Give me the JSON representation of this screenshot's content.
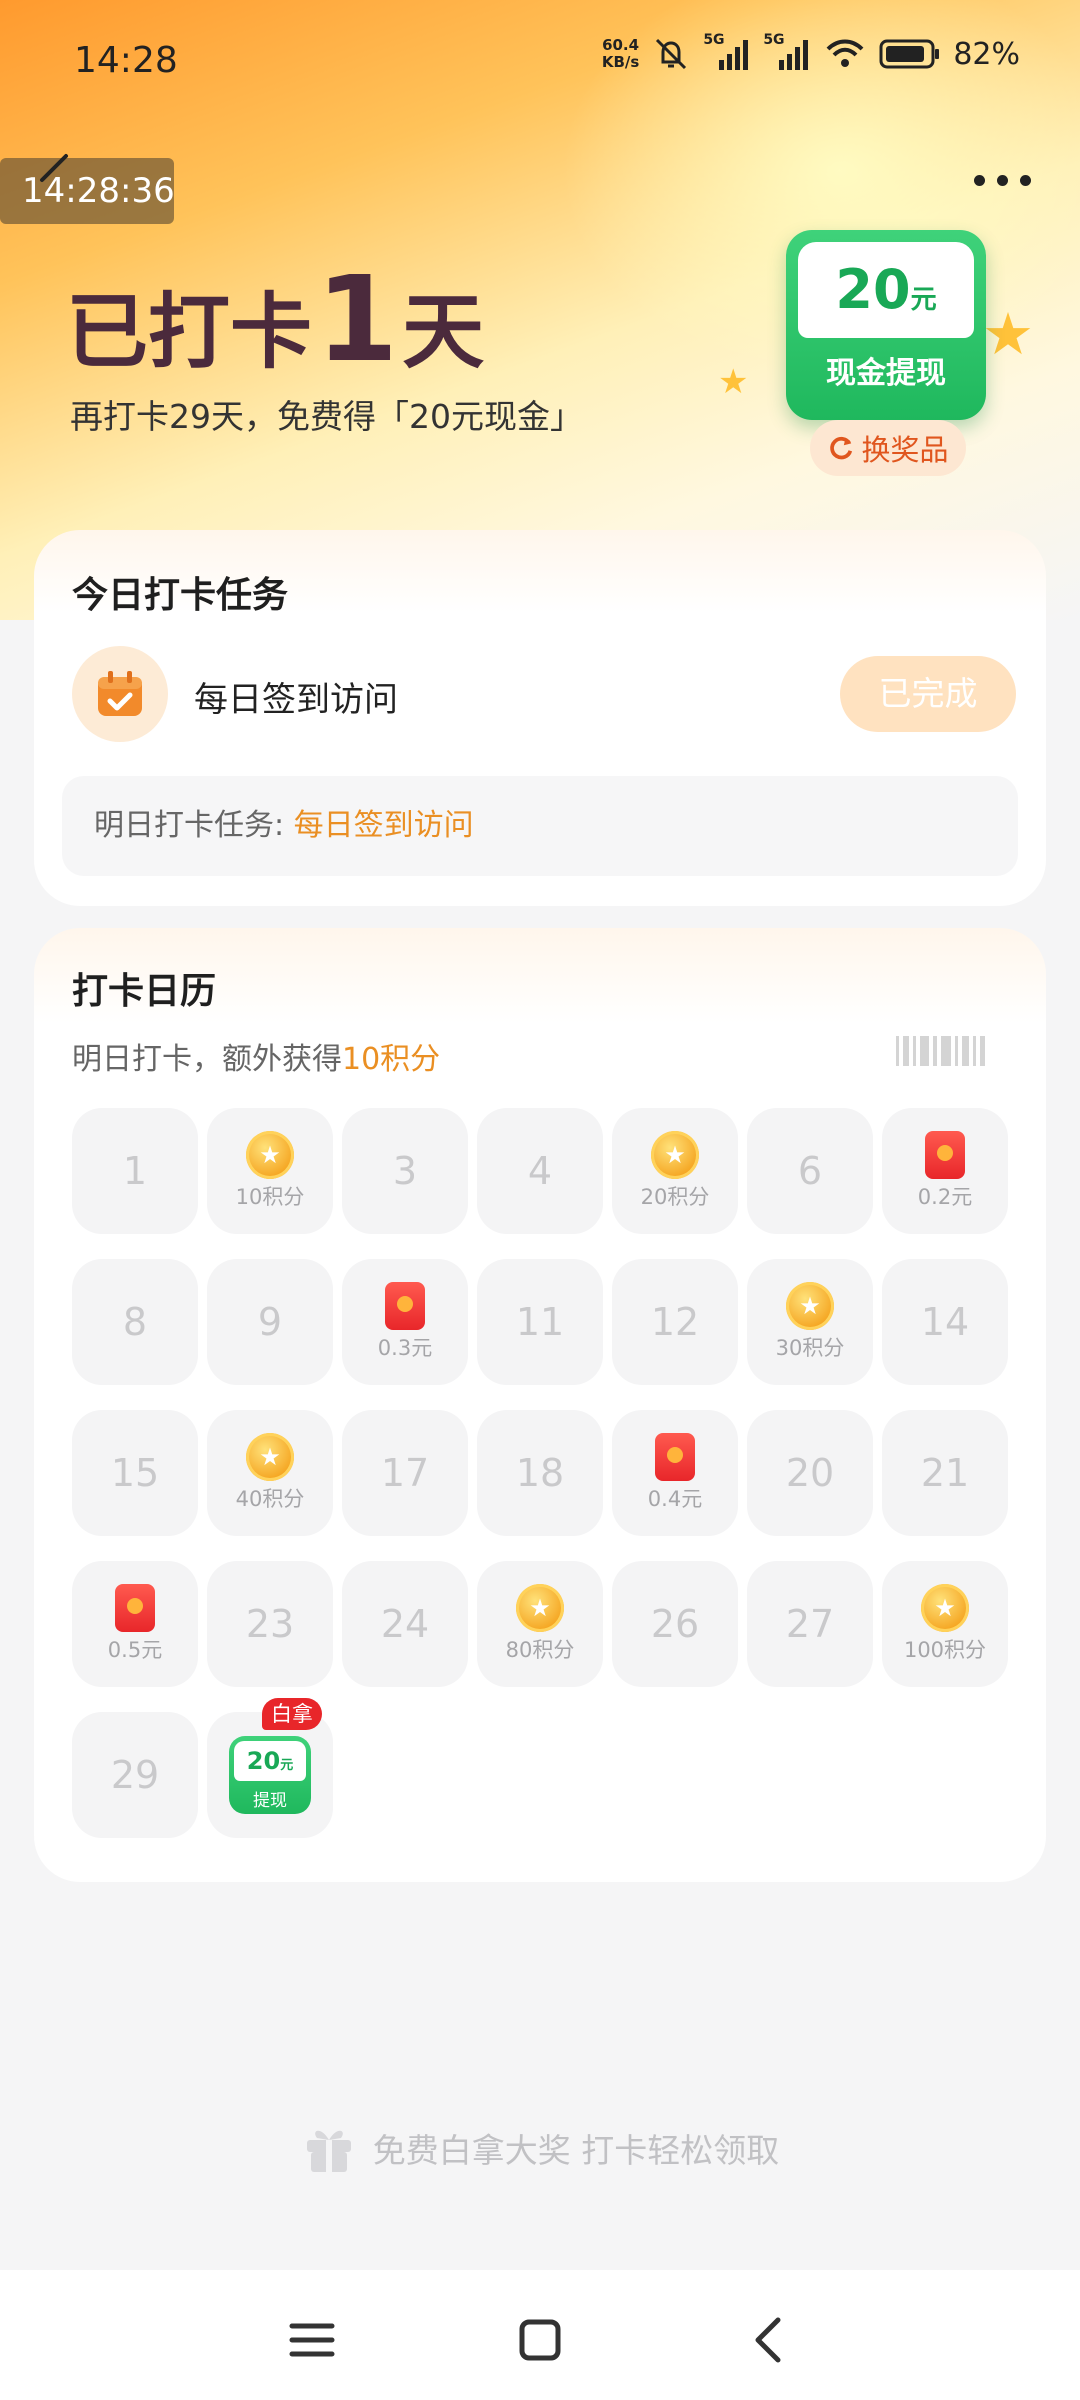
{
  "status_bar": {
    "time": "14:28",
    "net_speed_value": "60.4",
    "net_speed_unit": "KB/s",
    "signal1_label": "5G",
    "signal2_label": "5G",
    "battery": "82%",
    "icons": [
      "bell-off-icon",
      "signal-icon",
      "signal-icon",
      "wifi-icon",
      "battery-icon"
    ]
  },
  "overlay": {
    "timer": "14:28:36"
  },
  "header": {
    "headline_prefix": "已打卡",
    "headline_days": "1",
    "headline_suffix": "天",
    "subline": "再打卡29天，免费得「20元现金」"
  },
  "reward": {
    "amount": "20",
    "unit": "元",
    "label": "现金提现",
    "exchange_label": "换奖品"
  },
  "task_card": {
    "title": "今日打卡任务",
    "task_name": "每日签到访问",
    "task_status": "已完成",
    "tomorrow_prefix": "明日打卡任务:",
    "tomorrow_task": "每日签到访问"
  },
  "calendar": {
    "title": "打卡日历",
    "sub_prefix": "明日打卡，额外获得",
    "sub_highlight": "10积分",
    "days": [
      {
        "day": "1"
      },
      {
        "reward": "coin",
        "label": "10积分"
      },
      {
        "day": "3"
      },
      {
        "day": "4"
      },
      {
        "reward": "coin",
        "label": "20积分"
      },
      {
        "day": "6"
      },
      {
        "reward": "redpack",
        "label": "0.2元"
      },
      {
        "day": "8"
      },
      {
        "day": "9"
      },
      {
        "reward": "redpack",
        "label": "0.3元"
      },
      {
        "day": "11"
      },
      {
        "day": "12"
      },
      {
        "reward": "coin",
        "label": "30积分"
      },
      {
        "day": "14"
      },
      {
        "day": "15"
      },
      {
        "reward": "coin",
        "label": "40积分"
      },
      {
        "day": "17"
      },
      {
        "day": "18"
      },
      {
        "reward": "redpack",
        "label": "0.4元"
      },
      {
        "day": "20"
      },
      {
        "day": "21"
      },
      {
        "reward": "redpack",
        "label": "0.5元"
      },
      {
        "day": "23"
      },
      {
        "day": "24"
      },
      {
        "reward": "coin",
        "label": "80积分"
      },
      {
        "day": "26"
      },
      {
        "day": "27"
      },
      {
        "reward": "coin",
        "label": "100积分"
      },
      {
        "day": "29"
      },
      {
        "reward": "grand"
      }
    ],
    "grand_prize": {
      "amount": "20",
      "unit": "元",
      "label": "提现",
      "tag": "白拿"
    }
  },
  "footer": {
    "promo": "免费白拿大奖 打卡轻松领取"
  },
  "colors": {
    "accent_orange": "#ea8f23",
    "brand_green": "#1fb85d",
    "headline": "#4b2a3c",
    "red": "#e8262a"
  }
}
